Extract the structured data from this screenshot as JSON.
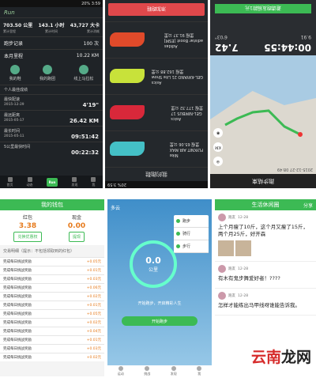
{
  "p1": {
    "app_logo": "Run",
    "stats": [
      {
        "value": "703.50 公里",
        "label": "累计里程"
      },
      {
        "value": "143.1 小时",
        "label": "累计时间"
      },
      {
        "value": "43,727 大卡",
        "label": "累计消耗"
      }
    ],
    "record_label": "跑步记录",
    "record_count": "100 次",
    "month_label": "本月里程",
    "month_value": "10.22 KM",
    "icons": [
      "我的鞋",
      "我的跑团",
      "线上马拉松"
    ],
    "best_label": "个人最佳成绩",
    "records": [
      {
        "title": "最快配速",
        "value": "4'19\"",
        "date": "2015-12-29"
      },
      {
        "title": "最远距离",
        "value": "26.42 KM",
        "date": "2015-05-17"
      },
      {
        "title": "最长时间",
        "value": "09:51:42",
        "date": "2015-05-11"
      },
      {
        "title": "5公里最快时间",
        "value": "00:22:32",
        "date": ""
      }
    ],
    "tabs": [
      "首页",
      "动态",
      "Run",
      "发现",
      "我"
    ]
  },
  "p2": {
    "title": "我的跑鞋",
    "shoes": [
      {
        "name": "Nike",
        "model": "FLYKNIT AIR MAX",
        "km": "里程 65.06 公里",
        "color": "#44c0c6"
      },
      {
        "name": "Asics",
        "model": "GEL-NIMBUS 17",
        "km": "里程 177.32 公里",
        "color": "#d8283a"
      },
      {
        "name": "Asics",
        "model": "GEL-KAYANO 21 Lite Show",
        "km": "里程 162.88 公里",
        "color": "#c8e23a"
      },
      {
        "name": "Adidas",
        "model": "adistar Boost [ESM]",
        "km": "里程 91.37 公里",
        "color": "#e04a2a"
      }
    ],
    "add_button": "添加跑鞋"
  },
  "p3": {
    "title": "跑步结束",
    "date": "2015-12-27 08:49",
    "duration": "00:44:55",
    "distance": "7.42",
    "calories": "9.91",
    "pace": "6'03\"",
    "share_check": "分享至跑友圈",
    "share_button": "邀请跑友捐款1元"
  },
  "p4": {
    "title": "我的钱包",
    "balance": [
      {
        "label": "红包",
        "amount": "3.38",
        "button": "兑换优惠权"
      },
      {
        "label": "现金",
        "amount": "0.00",
        "button": "提现"
      }
    ],
    "list_header": "交易明细（提示：不包括领取到的红包）",
    "rows": [
      {
        "name": "完成每日挑战奖励",
        "amount": "+0.05元"
      },
      {
        "name": "完成每日挑战奖励",
        "amount": "+0.01元"
      },
      {
        "name": "完成每日挑战奖励",
        "amount": "+0.03元"
      },
      {
        "name": "完成每日挑战奖励",
        "amount": "+0.06元"
      },
      {
        "name": "完成每日挑战奖励",
        "amount": "+0.02元"
      },
      {
        "name": "完成每日挑战奖励",
        "amount": "+0.01元"
      },
      {
        "name": "完成每日挑战奖励",
        "amount": "+0.05元"
      },
      {
        "name": "完成每日挑战奖励",
        "amount": "+0.02元"
      },
      {
        "name": "完成每日挑战奖励",
        "amount": "+0.04元"
      },
      {
        "name": "完成每日挑战奖励",
        "amount": "+0.01元"
      },
      {
        "name": "完成每日挑战奖励",
        "amount": "+0.03元"
      },
      {
        "name": "完成每日挑战奖励",
        "amount": "+0.02元"
      }
    ]
  },
  "p5": {
    "weather": "多云",
    "ring_value": "0.0",
    "ring_unit": "公里",
    "menu": [
      "跑步",
      "骑行",
      "步行"
    ],
    "banner": "开始跑步，开启精彩人生",
    "start_button": "开始跑步",
    "nav": [
      "运动",
      "挑战",
      "发现",
      "我"
    ]
  },
  "p6": {
    "title": "生活休闲圈",
    "share": "分享",
    "posts": [
      {
        "user": "跑友",
        "time": "12-28",
        "text": "上个月瘦了10斤，这个月又瘦了15斤，两个月25斤，好开森"
      },
      {
        "user": "跑友",
        "time": "12-28",
        "text": "有木有鬼步舞爱好者！????"
      },
      {
        "user": "跑友",
        "time": "12-28",
        "text": "怎样才能练出马甲线呀谁能告诉我。"
      }
    ]
  },
  "watermark": {
    "red": "云南",
    "dark": "龙网"
  }
}
